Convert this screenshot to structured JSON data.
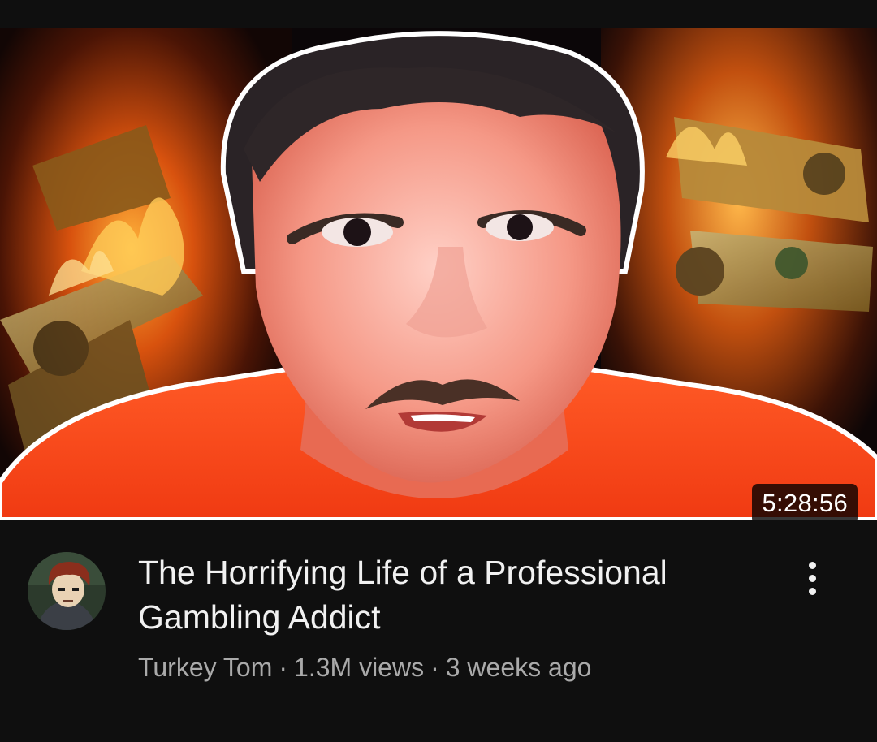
{
  "video": {
    "title": "The Horrifying Life of a Professional Gambling Addict",
    "duration": "5:28:56",
    "channel": "Turkey Tom",
    "views": "1.3M views",
    "age": "3 weeks ago",
    "separator": "·"
  },
  "icons": {
    "more_actions": "more-vertical-icon",
    "avatar": "channel-avatar"
  },
  "colors": {
    "background": "#0f0f0f",
    "title_text": "#f1f1f1",
    "secondary_text": "#aaaaaa",
    "duration_badge": "#000000",
    "thumbnail_shirt": "#ff4a1c",
    "thumbnail_fire": "#ff9a20"
  }
}
